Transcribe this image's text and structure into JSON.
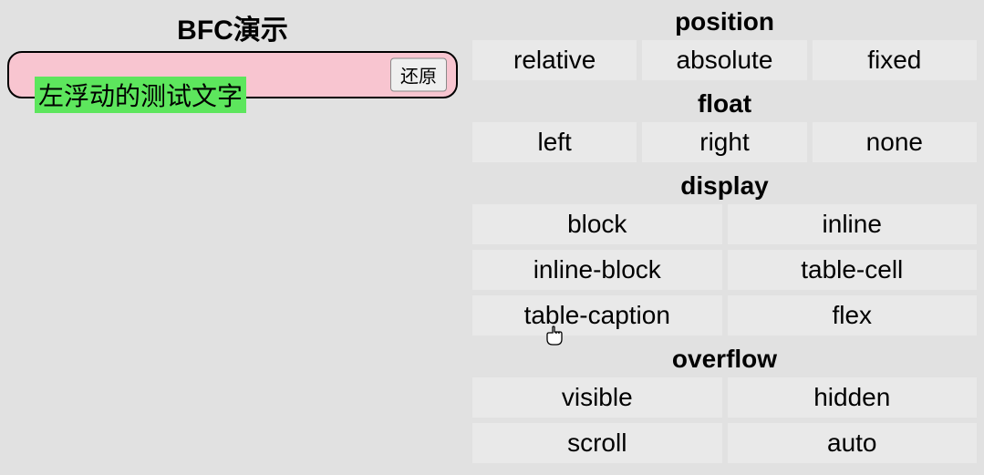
{
  "title": "BFC演示",
  "floatText": "左浮动的测试文字",
  "resetButton": "还原",
  "sections": {
    "position": {
      "label": "position",
      "options": [
        "relative",
        "absolute",
        "fixed"
      ]
    },
    "float": {
      "label": "float",
      "options": [
        "left",
        "right",
        "none"
      ]
    },
    "display": {
      "label": "display",
      "options": [
        "block",
        "inline",
        "inline-block",
        "table-cell",
        "table-caption",
        "flex"
      ]
    },
    "overflow": {
      "label": "overflow",
      "options": [
        "visible",
        "hidden",
        "scroll",
        "auto"
      ]
    }
  }
}
